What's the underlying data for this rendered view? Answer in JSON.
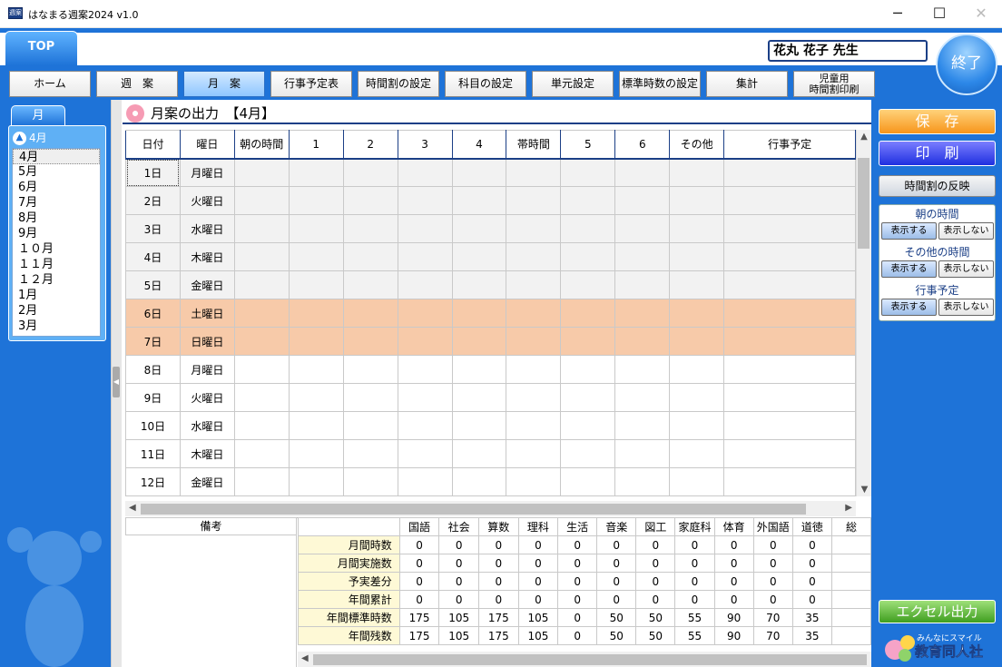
{
  "window": {
    "title": "はなまる週案2024 v1.0",
    "icon_label": "週案",
    "minimize": "─",
    "maximize": "☐",
    "close": "✕"
  },
  "header": {
    "top_tab": "TOP",
    "teacher": "花丸 花子 先生",
    "exit": "終了"
  },
  "nav": [
    {
      "label": "ホーム"
    },
    {
      "label": "週　案"
    },
    {
      "label": "月　案"
    },
    {
      "label": "行事予定表"
    },
    {
      "label": "時間割の設定"
    },
    {
      "label": "科目の設定"
    },
    {
      "label": "単元設定"
    },
    {
      "label": "標準時数の設定"
    },
    {
      "label": "集計"
    },
    {
      "label": "児童用\n時間割印刷"
    }
  ],
  "active_nav": "月　案",
  "month_panel": {
    "tab": "月",
    "current": "4月",
    "months": [
      "4月",
      "5月",
      "6月",
      "7月",
      "8月",
      "9月",
      "１０月",
      "１１月",
      "１２月",
      "1月",
      "2月",
      "3月"
    ],
    "selected": "4月"
  },
  "section": {
    "title": "月案の出力　【4月】"
  },
  "grid": {
    "columns": [
      "日付",
      "曜日",
      "朝の時間",
      "1",
      "2",
      "3",
      "4",
      "帯時間",
      "5",
      "6",
      "その他",
      "行事予定"
    ],
    "rows": [
      {
        "date": "1日",
        "day": "月曜日",
        "type": "weekday"
      },
      {
        "date": "2日",
        "day": "火曜日",
        "type": "weekday"
      },
      {
        "date": "3日",
        "day": "水曜日",
        "type": "weekday"
      },
      {
        "date": "4日",
        "day": "木曜日",
        "type": "weekday"
      },
      {
        "date": "5日",
        "day": "金曜日",
        "type": "weekday"
      },
      {
        "date": "6日",
        "day": "土曜日",
        "type": "weekend"
      },
      {
        "date": "7日",
        "day": "日曜日",
        "type": "weekend"
      },
      {
        "date": "8日",
        "day": "月曜日",
        "type": "future"
      },
      {
        "date": "9日",
        "day": "火曜日",
        "type": "future"
      },
      {
        "date": "10日",
        "day": "水曜日",
        "type": "future"
      },
      {
        "date": "11日",
        "day": "木曜日",
        "type": "future"
      },
      {
        "date": "12日",
        "day": "金曜日",
        "type": "future"
      }
    ],
    "colors": {
      "weekday": "#f2f2f2",
      "weekend": "#f7caa9",
      "future": "#ffffff"
    }
  },
  "summary": {
    "note_header": "備考",
    "subjects": [
      "国語",
      "社会",
      "算数",
      "理科",
      "生活",
      "音楽",
      "図工",
      "家庭科",
      "体育",
      "外国語",
      "道徳",
      "総"
    ],
    "rows": [
      {
        "label": "月間時数",
        "values": [
          "0",
          "0",
          "0",
          "0",
          "0",
          "0",
          "0",
          "0",
          "0",
          "0",
          "0",
          ""
        ]
      },
      {
        "label": "月間実施数",
        "values": [
          "0",
          "0",
          "0",
          "0",
          "0",
          "0",
          "0",
          "0",
          "0",
          "0",
          "0",
          ""
        ]
      },
      {
        "label": "予実差分",
        "values": [
          "0",
          "0",
          "0",
          "0",
          "0",
          "0",
          "0",
          "0",
          "0",
          "0",
          "0",
          ""
        ]
      },
      {
        "label": "年間累計",
        "values": [
          "0",
          "0",
          "0",
          "0",
          "0",
          "0",
          "0",
          "0",
          "0",
          "0",
          "0",
          ""
        ]
      },
      {
        "label": "年間標準時数",
        "values": [
          "175",
          "105",
          "175",
          "105",
          "0",
          "50",
          "50",
          "55",
          "90",
          "70",
          "35",
          ""
        ]
      },
      {
        "label": "年間残数",
        "values": [
          "175",
          "105",
          "175",
          "105",
          "0",
          "50",
          "50",
          "55",
          "90",
          "70",
          "35",
          ""
        ]
      }
    ]
  },
  "right": {
    "save": "保　存",
    "print": "印　刷",
    "reflect": "時間割の反映",
    "toggles": [
      {
        "label": "朝の時間",
        "show": "表示する",
        "hide": "表示しない"
      },
      {
        "label": "その他の時間",
        "show": "表示する",
        "hide": "表示しない"
      },
      {
        "label": "行事予定",
        "show": "表示する",
        "hide": "表示しない"
      }
    ],
    "excel": "エクセル出力",
    "logo_sub": "みんなにスマイル",
    "logo_main": "教育同人社"
  },
  "accent": {
    "blue": "#1e73d8",
    "navy": "#1b3f86",
    "orange": "#f7951b",
    "green": "#3f9e1f"
  }
}
